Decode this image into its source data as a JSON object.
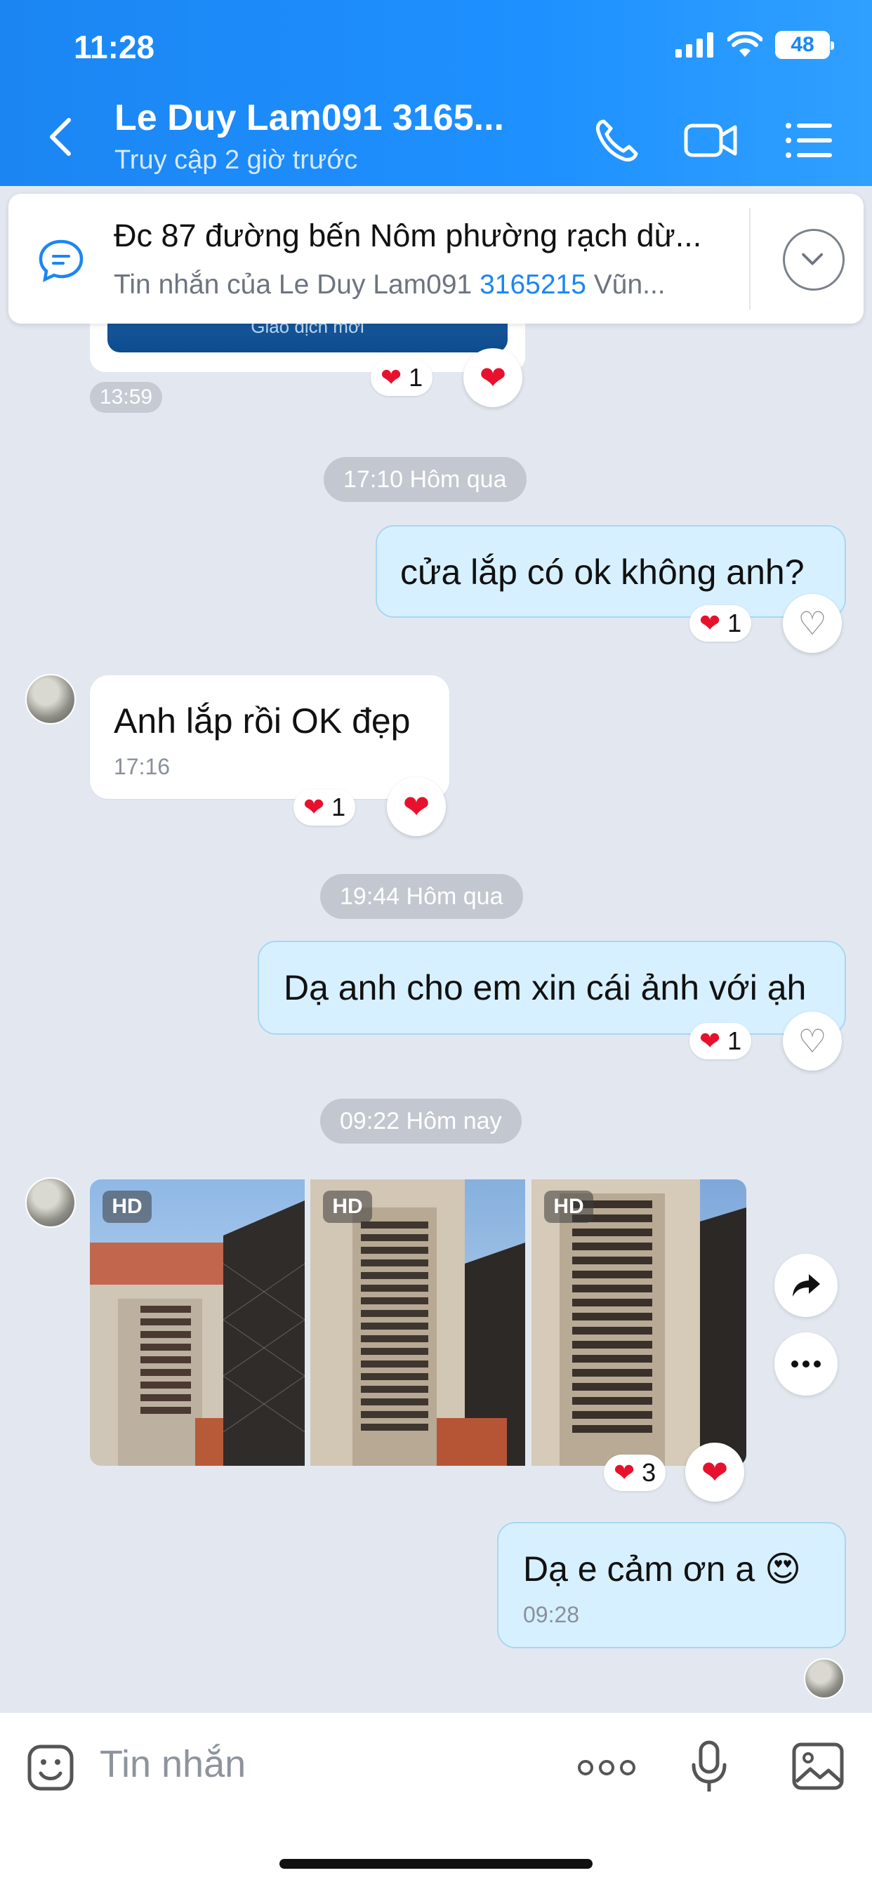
{
  "status_bar": {
    "time": "11:28",
    "battery": "48"
  },
  "header": {
    "contact_name": "Le Duy Lam091 3165...",
    "last_seen": "Truy cập 2 giờ trước"
  },
  "pinned": {
    "title": "Đc 87 đường bến Nôm phường rạch dừ...",
    "sub_prefix": "Tin nhắn của Le Duy Lam091 ",
    "sub_link": "3165215",
    "sub_suffix": " Vũn..."
  },
  "prev_message": {
    "banner_text": "Giao dịch mới",
    "time": "13:59",
    "reaction_count": "1"
  },
  "conversation": {
    "date1": "17:10 Hôm qua",
    "msg1": {
      "text": "cửa lắp có ok không anh?",
      "reaction_count": "1"
    },
    "msg2": {
      "text": "Anh lắp rồi OK đẹp",
      "time": "17:16",
      "reaction_count": "1"
    },
    "date2": "19:44 Hôm qua",
    "msg3": {
      "text": "Dạ anh cho em xin cái ảnh với ạh",
      "reaction_count": "1"
    },
    "date3": "09:22 Hôm nay",
    "photos": {
      "badge": "HD",
      "reaction_count": "3"
    },
    "msg4": {
      "text": "Dạ  e cảm ơn a 😍",
      "time": "09:28"
    }
  },
  "input": {
    "placeholder": "Tin nhắn"
  },
  "colors": {
    "header_blue": "#1e90ff",
    "outgoing_bubble": "#d6f0ff",
    "heart_red": "#e8112d",
    "link_blue": "#1b86f2"
  }
}
